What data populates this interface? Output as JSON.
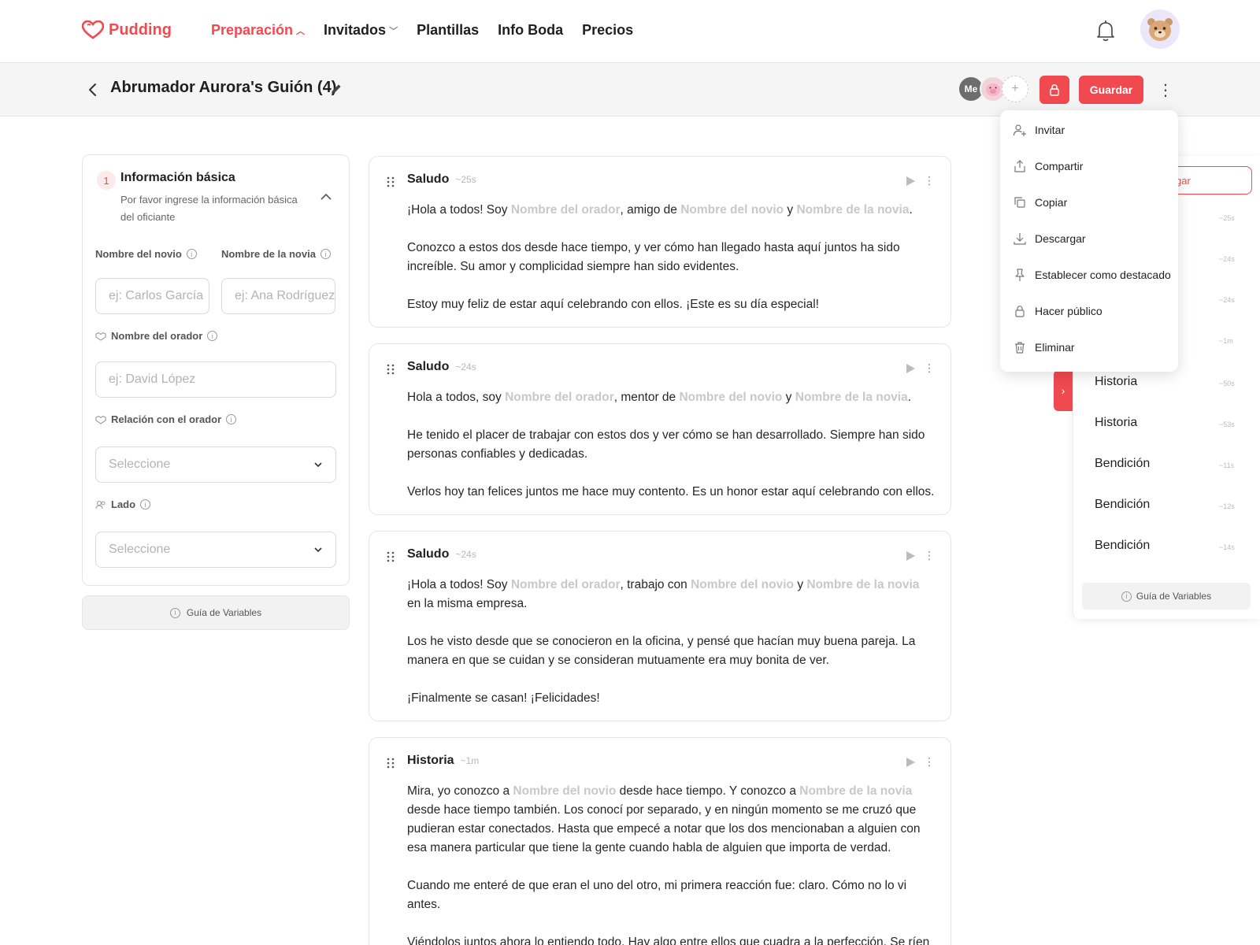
{
  "brand": {
    "name": "Pudding"
  },
  "nav": {
    "items": [
      {
        "label": "Preparación",
        "active": true,
        "dropdown": true
      },
      {
        "label": "Invitados",
        "active": false,
        "dropdown": true
      },
      {
        "label": "Plantillas",
        "active": false,
        "dropdown": false
      },
      {
        "label": "Info Boda",
        "active": false,
        "dropdown": false
      },
      {
        "label": "Precios",
        "active": false,
        "dropdown": false
      }
    ]
  },
  "header": {
    "title": "Abrumador Aurora's Guión (4)",
    "collaborators": [
      "Me"
    ],
    "add_label": "+",
    "save_label": "Guardar"
  },
  "menu": {
    "items": [
      {
        "label": "Invitar",
        "icon": "user-plus-icon"
      },
      {
        "label": "Compartir",
        "icon": "share-icon"
      },
      {
        "label": "Copiar",
        "icon": "copy-icon"
      },
      {
        "label": "Descargar",
        "icon": "download-icon"
      },
      {
        "label": "Establecer como destacado",
        "icon": "pin-icon"
      },
      {
        "label": "Hacer público",
        "icon": "lock-icon"
      },
      {
        "label": "Eliminar",
        "icon": "trash-icon"
      }
    ]
  },
  "left": {
    "step": "1",
    "title": "Información básica",
    "subtitle": "Por favor ingrese la información básica del oficiante",
    "groom_label": "Nombre del novio",
    "bride_label": "Nombre de la novia",
    "groom_placeholder": "ej: Carlos García",
    "bride_placeholder": "ej: Ana Rodríguez",
    "speaker_label": "Nombre del orador",
    "speaker_placeholder": "ej: David López",
    "relation_label": "Relación con el orador",
    "relation_value": "Seleccione",
    "side_label": "Lado",
    "side_value": "Seleccione",
    "guide_label": "Guía de Variables"
  },
  "cards": [
    {
      "title": "Saludo",
      "duration": "~25s",
      "p1_a": "¡Hola a todos! Soy ",
      "p1_v1": "Nombre del orador",
      "p1_b": ", amigo de ",
      "p1_v2": "Nombre del novio",
      "p1_c": " y ",
      "p1_v3": "Nombre de la novia",
      "p1_d": ".",
      "p2": "Conozco a estos dos desde hace tiempo, y ver cómo han llegado hasta aquí juntos ha sido increíble. Su amor y complicidad siempre han sido evidentes.",
      "p3": "Estoy muy feliz de estar aquí celebrando con ellos. ¡Este es su día especial!"
    },
    {
      "title": "Saludo",
      "duration": "~24s",
      "p1_a": "Hola a todos, soy ",
      "p1_v1": "Nombre del orador",
      "p1_b": ", mentor de ",
      "p1_v2": "Nombre del novio",
      "p1_c": " y ",
      "p1_v3": "Nombre de la novia",
      "p1_d": ".",
      "p2": "He tenido el placer de trabajar con estos dos y ver cómo se han desarrollado. Siempre han sido personas confiables y dedicadas.",
      "p3": "Verlos hoy tan felices juntos me hace muy contento. Es un honor estar aquí celebrando con ellos."
    },
    {
      "title": "Saludo",
      "duration": "~24s",
      "p1_a": "¡Hola a todos! Soy ",
      "p1_v1": "Nombre del orador",
      "p1_b": ", trabajo con ",
      "p1_v2": "Nombre del novio",
      "p1_c": " y ",
      "p1_v3": "Nombre de la novia",
      "p1_d": " en la misma empresa.",
      "p2": "Los he visto desde que se conocieron en la oficina, y pensé que hacían muy buena pareja. La manera en que se cuidan y se consideran mutuamente era muy bonita de ver.",
      "p3": "¡Finalmente se casan! ¡Felicidades!"
    },
    {
      "title": "Historia",
      "duration": "~1m",
      "p1_a": "Mira, yo conozco a ",
      "p1_v1": "Nombre del novio",
      "p1_b": " desde hace tiempo. Y conozco a ",
      "p1_v2": "Nombre de la novia",
      "p1_c": " desde hace tiempo también. Los conocí por separado, y en ningún momento se me cruzó que pudieran estar conectados. Hasta que empecé a notar que los dos mencionaban a alguien con esa manera particular que tiene la gente cuando habla de alguien que importa de verdad.",
      "p2": "Cuando me enteré de que eran el uno del otro, mi primera reacción fue: claro. Cómo no lo vi antes.",
      "p3": "Viéndolos juntos ahora lo entiendo todo. Hay algo entre ellos que cuadra a la perfección. Se ríen de las mismas cosas, se complementan donde el otro necesita, y cuando están en el mismo cuarto se"
    }
  ],
  "right": {
    "button_label": "gar",
    "items": [
      {
        "label": "",
        "duration": "~25s"
      },
      {
        "label": "",
        "duration": "~24s"
      },
      {
        "label": "",
        "duration": "~24s"
      },
      {
        "label": "",
        "duration": "~1m"
      },
      {
        "label": "Historia",
        "duration": "~50s"
      },
      {
        "label": "Historia",
        "duration": "~53s"
      },
      {
        "label": "Bendición",
        "duration": "~11s"
      },
      {
        "label": "Bendición",
        "duration": "~12s"
      },
      {
        "label": "Bendición",
        "duration": "~14s"
      }
    ],
    "guide_label": "Guía de Variables"
  },
  "colors": {
    "accent": "#f0494f",
    "variable": "#c8c8c8"
  }
}
